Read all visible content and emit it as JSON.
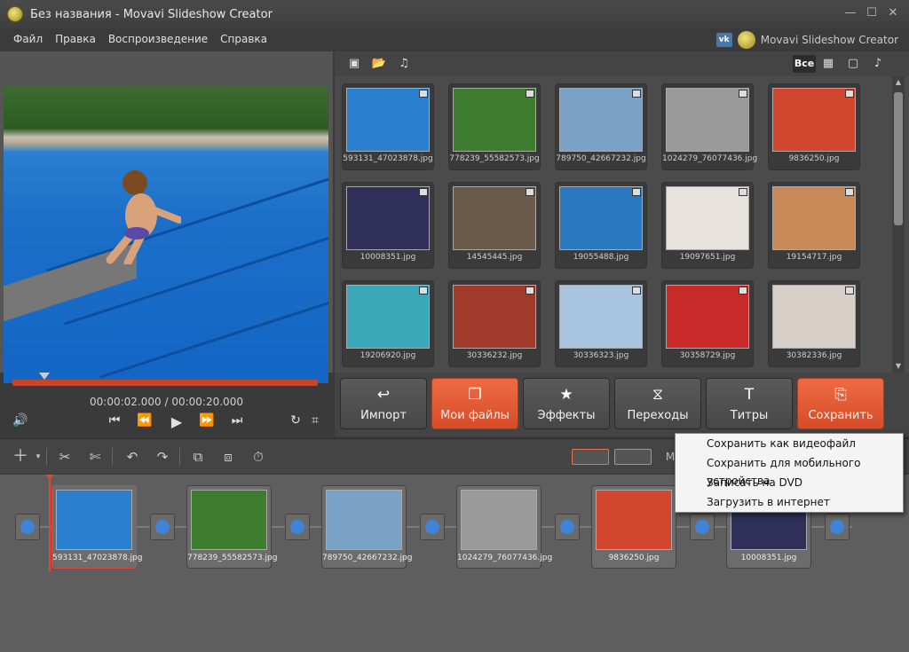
{
  "window": {
    "title": "Без названия - Movavi Slideshow Creator"
  },
  "menu": {
    "items": [
      "Файл",
      "Правка",
      "Воспроизведение",
      "Справка"
    ]
  },
  "brand": {
    "vk": "vk",
    "name": "Movavi Slideshow Creator"
  },
  "player": {
    "time_current": "00:00:02.000",
    "time_separator": "/",
    "time_total": "00:00:20.000"
  },
  "gallery": {
    "filter_all": "Все",
    "items": [
      {
        "name": "593131_47023878.jpg",
        "color": "#2b7fcf"
      },
      {
        "name": "778239_55582573.jpg",
        "color": "#3e7d2f"
      },
      {
        "name": "789750_42667232.jpg",
        "color": "#7aa1c6"
      },
      {
        "name": "1024279_76077436.jpg",
        "color": "#9a9a9a"
      },
      {
        "name": "9836250.jpg",
        "color": "#d2452f"
      },
      {
        "name": "10008351.jpg",
        "color": "#2f2f5a"
      },
      {
        "name": "14545445.jpg",
        "color": "#6a5a4a"
      },
      {
        "name": "19055488.jpg",
        "color": "#2a78c0"
      },
      {
        "name": "19097651.jpg",
        "color": "#e8e2dc"
      },
      {
        "name": "19154717.jpg",
        "color": "#c98a5a"
      },
      {
        "name": "19206920.jpg",
        "color": "#3aa8b8"
      },
      {
        "name": "30336232.jpg",
        "color": "#a03a2a"
      },
      {
        "name": "30336323.jpg",
        "color": "#a8c4de"
      },
      {
        "name": "30358729.jpg",
        "color": "#c82a2a"
      },
      {
        "name": "30382336.jpg",
        "color": "#d8d0c8"
      }
    ]
  },
  "actions": [
    {
      "label": "Импорт",
      "icon": "↩",
      "style": "gray"
    },
    {
      "label": "Мои файлы",
      "icon": "❐",
      "style": "orange"
    },
    {
      "label": "Эффекты",
      "icon": "★",
      "style": "gray"
    },
    {
      "label": "Переходы",
      "icon": "⧖",
      "style": "gray"
    },
    {
      "label": "Титры",
      "icon": "T",
      "style": "gray"
    },
    {
      "label": "Сохранить",
      "icon": "⎘",
      "style": "orange"
    }
  ],
  "timeline_toolbar": {
    "mode_label": "M"
  },
  "timeline": {
    "slides": [
      {
        "name": "593131_47023878.jpg",
        "color": "#2b7fcf"
      },
      {
        "name": "778239_55582573.jpg",
        "color": "#3e7d2f"
      },
      {
        "name": "789750_42667232.jpg",
        "color": "#7aa1c6"
      },
      {
        "name": "1024279_76077436.jpg",
        "color": "#9a9a9a"
      },
      {
        "name": "9836250.jpg",
        "color": "#d2452f"
      },
      {
        "name": "10008351.jpg",
        "color": "#2f2f5a"
      }
    ]
  },
  "save_menu": {
    "items": [
      "Сохранить как видеофайл",
      "Сохранить для мобильного устройства",
      "Записать на DVD",
      "Загрузить в интернет"
    ]
  },
  "colors": {
    "accent": "#e35a33",
    "panel": "#4b4b4b"
  }
}
